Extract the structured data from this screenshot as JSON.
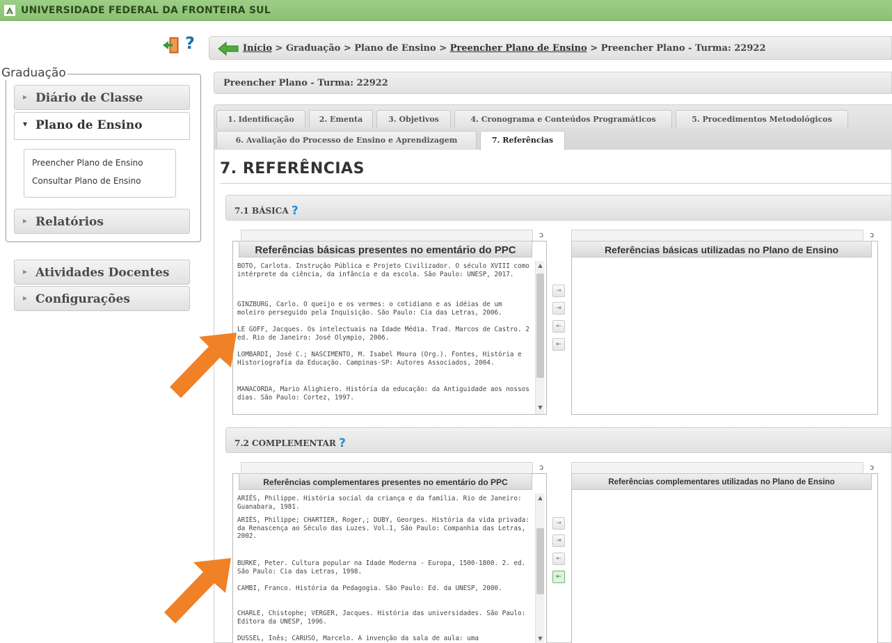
{
  "topbar": {
    "title": "UNIVERSIDADE FEDERAL DA FRONTEIRA SUL"
  },
  "header_icons": {
    "exit": "exit-door-icon",
    "help": "?"
  },
  "breadcrumb": {
    "home": "Início",
    "sep1": " > ",
    "item2": "Graduação",
    "sep2": " > ",
    "item3": "Plano de Ensino",
    "sep3": " > ",
    "item4": "Preencher Plano de Ensino",
    "sep4": " > ",
    "item5": "Preencher Plano - Turma: 22922"
  },
  "sidebar": {
    "legend": "Graduação",
    "items": [
      {
        "label": "Diário de Classe",
        "caret": "▸"
      },
      {
        "label": "Plano de Ensino",
        "caret": "▾"
      },
      {
        "label": "Relatórios",
        "caret": "▸"
      },
      {
        "label": "Atividades Docentes",
        "caret": "▸"
      },
      {
        "label": "Configurações",
        "caret": "▸"
      }
    ],
    "submenu": [
      "Preencher Plano de Ensino",
      "Consultar Plano de Ensino"
    ]
  },
  "page_header": "Preencher Plano - Turma: 22922",
  "tabs": [
    "1. Identificação",
    "2. Ementa",
    "3. Objetivos",
    "4. Cronograma e Conteúdos Programáticos",
    "5. Procedimentos Metodológicos",
    "6. Avaliação do Processo de Ensino e Aprendizagem",
    "7. Referências"
  ],
  "section_title": "7. REFERÊNCIAS",
  "basica": {
    "heading": "7.1 BÁSICA",
    "help": "?",
    "source_caption": "Referências básicas presentes no ementário do PPC",
    "target_caption": "Referências básicas utilizadas no Plano de Ensino",
    "items": [
      "BOTO, Carlota. Instrução Pública e Projeto Civilizador. O século XVIII como intérprete da ciência, da infância e da escola. São Paulo: UNESP, 2017.",
      "GINZBURG, Carlo. O queijo e os vermes: o cotidiano e as idéias de um moleiro perseguido pela Inquisição. São Paulo: Cia das Letras, 2006.",
      "LE GOFF, Jacques. Os intelectuais na Idade Média. Trad. Marcos de Castro. 2 ed. Rio de Janeiro: José Olympio, 2006.",
      "LOMBARDI, José C.; NASCIMENTO, M. Isabel Moura (Org.). Fontes, História e Historiografia da Educação. Campinas-SP: Autores Associados, 2004.",
      "MANACORDA, Mario Alighiero. História da educação: da Antiguidade aos nossos dias. São Paulo: Cortez, 1997."
    ]
  },
  "complementar": {
    "heading": "7.2 COMPLEMENTAR",
    "help": "?",
    "source_caption": "Referências complementares presentes no ementário do PPC",
    "target_caption": "Referências complementares utilizadas no Plano de Ensino",
    "items": [
      "ARIÈS, Philippe. História social da criança e da família. Rio de Janeiro: Guanabara, 1981.",
      "ARIÈS, Philippe; CHARTIER, Roger,; DUBY, Georges. História da vida privada: da Renascença ao Século das Luzes. Vol.1, São Paulo: Companhia das Letras, 2002.",
      "BURKE, Peter. Cultura popular na Idade Moderna - Europa, 1500-1800. 2. ed. São Paulo: Cia das Letras, 1998.",
      "CAMBI, Franco. História da Pedagogia. São Paulo: Ed. da UNESP, 2000.",
      "CHARLE, Chistophe; VERGER, Jacques. História das universidades. São Paulo: Editora da UNESP, 1996.",
      "DUSSEL, Inês; CARUSO, Marcelo. A invenção da sala de aula: uma"
    ]
  },
  "move_buttons": [
    "→",
    "⇥",
    "←",
    "⇤"
  ]
}
